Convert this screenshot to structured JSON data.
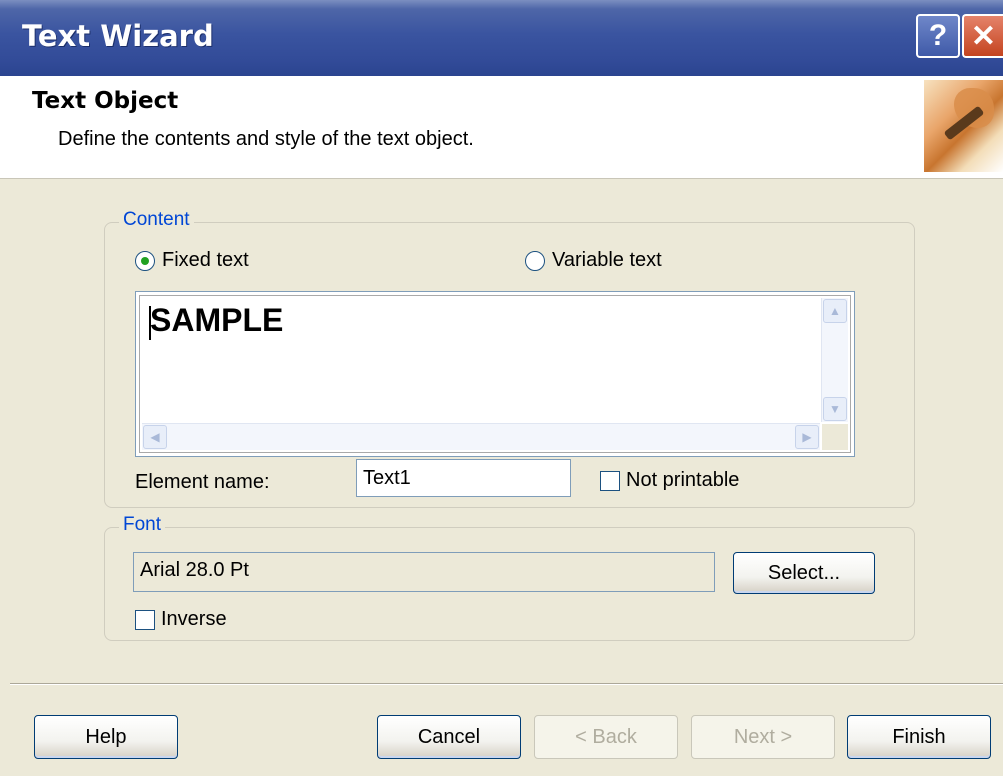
{
  "window": {
    "title": "Text Wizard",
    "help_glyph": "?",
    "close_glyph": "✕"
  },
  "header": {
    "title": "Text Object",
    "subtitle": "Define the contents and style of the text object."
  },
  "content": {
    "legend": "Content",
    "fixed_text_label": "Fixed text",
    "variable_text_label": "Variable text",
    "selected_mode": "fixed",
    "text_value": "SAMPLE",
    "element_name_label": "Element name:",
    "element_name_value": "Text1",
    "not_printable_label": "Not printable",
    "not_printable_checked": false
  },
  "font": {
    "legend": "Font",
    "current_font": "Arial 28.0 Pt",
    "select_label": "Select...",
    "inverse_label": "Inverse",
    "inverse_checked": false
  },
  "footer": {
    "help_label": "Help",
    "cancel_label": "Cancel",
    "back_label": "< Back",
    "next_label": "Next >",
    "finish_label": "Finish"
  },
  "colors": {
    "titlebar": "#324b98",
    "legend_text": "#0046d5",
    "dialog_bg": "#ece9d8",
    "radio_dot": "#21a121"
  }
}
